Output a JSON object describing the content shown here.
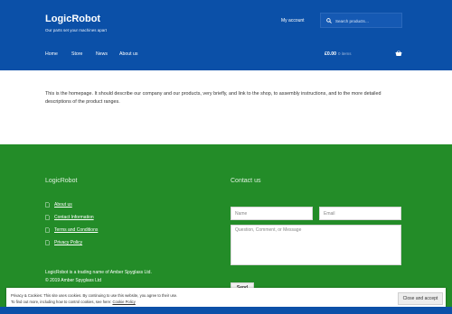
{
  "header": {
    "site_title": "LogicRobot",
    "tagline": "Our parts set your machines apart",
    "my_account": "My account",
    "search_placeholder": "Search products…",
    "nav": [
      "Home",
      "Store",
      "News",
      "About us"
    ],
    "cart_total": "£0.00",
    "cart_count": "0 items",
    "bg_color": "#0b50a8"
  },
  "content": {
    "text": "This is the homepage. It should describe our company and our products, very briefly, and link to the shop, to assembly instructions, and to the more detailed descriptions of the product ranges."
  },
  "footer": {
    "bg_color": "#238c28",
    "logo_text": "LogicRobot",
    "links": [
      "About us",
      "Contact Information",
      "Terms and Conditions",
      "Privacy Policy"
    ],
    "note_line1": "LogicRobot is a trading name of Amber Spyglass Ltd.",
    "note_line2": "© 2019 Amber Spyglass Ltd",
    "contact_title": "Contact us",
    "name_placeholder": "Name",
    "email_placeholder": "Email",
    "message_placeholder": "Question, Comment, or Message",
    "send_label": "Send"
  },
  "cookie_banner": {
    "line1": "Privacy & Cookies: This site uses cookies. By continuing to use this website, you agree to their use.",
    "line2_prefix": "To find out more, including how to control cookies, see here: ",
    "line2_link": "Cookie Policy",
    "button_label": "Close and accept"
  }
}
